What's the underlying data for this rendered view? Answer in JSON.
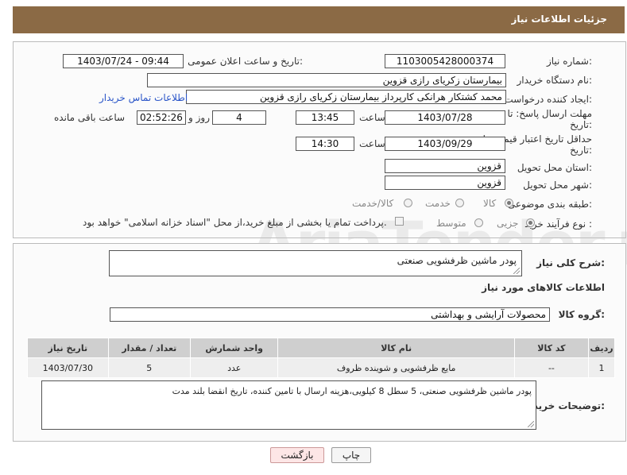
{
  "header": {
    "title": "جزئیات اطلاعات نیاز"
  },
  "form": {
    "need_number": {
      "label": "شماره نیاز:",
      "value": "1103005428000374"
    },
    "announce_dt": {
      "label": "تاریخ و ساعت اعلان عمومی:",
      "value": "1403/07/24 - 09:44"
    },
    "buyer_org": {
      "label": "نام دستگاه خریدار:",
      "value": "بیمارستان زکریای رازی قزوین"
    },
    "creator": {
      "label": "ایجاد کننده درخواست:",
      "value": "محمد کشتکار هرانکی کارپرداز بیمارستان زکریای رازی قزوین",
      "contact_link": "اطلاعات تماس خریدار"
    },
    "reply_deadline": {
      "label_line1": "مهلت ارسال پاسخ: تا",
      "label_line2": "تاریخ:",
      "date": "1403/07/28",
      "time_label": "ساعت",
      "time": "13:45",
      "days": "4",
      "days_label": "روز و",
      "remaining": "02:52:26",
      "remaining_label": "ساعت باقی مانده"
    },
    "price_validity": {
      "label_line1": "حداقل تاریخ اعتبار قیمت: تا",
      "label_line2": "تاریخ:",
      "date": "1403/09/29",
      "time_label": "ساعت",
      "time": "14:30"
    },
    "province": {
      "label": "استان محل تحویل:",
      "value": "قزوین"
    },
    "city": {
      "label": "شهر محل تحویل:",
      "value": "قزوین"
    },
    "category": {
      "label": "طبقه بندی موضوعی:",
      "options": [
        "کالا",
        "خدمت",
        "کالا/خدمت"
      ],
      "selected": 0
    },
    "process": {
      "label": "نوع فرآیند خرید :",
      "options": [
        "جزیی",
        "متوسط"
      ],
      "selected": 0,
      "payment_note": "پرداخت تمام یا بخشی از مبلغ خرید،از محل \"اسناد خزانه اسلامی\" خواهد بود."
    }
  },
  "details": {
    "summary_label": "شرح کلی نیاز:",
    "summary_value": "پودر ماشین ظرفشویی صنعتی",
    "goods_info_title": "اطلاعات کالاهای مورد نیاز",
    "goods_group_label": "گروه کالا:",
    "goods_group_value": "محصولات آرایشی و بهداشتی",
    "table": {
      "headers": [
        "ردیف",
        "کد کالا",
        "نام کالا",
        "واحد شمارش",
        "تعداد / مقدار",
        "تاریخ نیاز"
      ],
      "rows": [
        [
          "1",
          "--",
          "مایع ظرفشویی و شوینده ظروف",
          "عدد",
          "5",
          "1403/07/30"
        ]
      ]
    },
    "buyer_notes_label": "توضیحات خریدار:",
    "buyer_notes_value": "پودر ماشین ظرفشویی صنعتی، 5 سطل 8 کیلویی،هزینه ارسال با تامین کننده، تاریخ انقضا بلند مدت"
  },
  "buttons": {
    "print": "چاپ",
    "back": "بازگشت"
  },
  "watermark": "AriaTender.net",
  "colors": {
    "header": "#8b6a45",
    "link": "#2a55c8",
    "back_button": "#fde6e6"
  }
}
